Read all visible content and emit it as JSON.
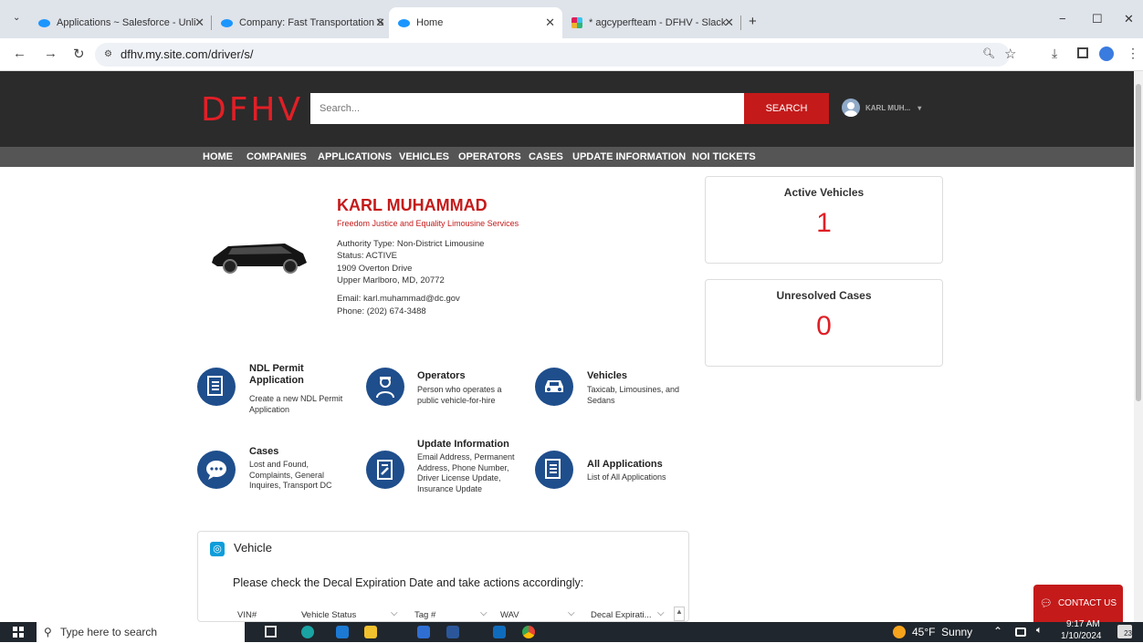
{
  "browser": {
    "tabs": [
      {
        "label": "Applications ~ Salesforce - Unli"
      },
      {
        "label": "Company: Fast Transportation S"
      },
      {
        "label": "Home"
      },
      {
        "label": "* agcyperfteam - DFHV - Slack"
      }
    ],
    "url": "dfhv.my.site.com/driver/s/"
  },
  "header": {
    "logo": "DFHV",
    "search_placeholder": "Search...",
    "search_button": "SEARCH",
    "user_name": "KARL MUH..."
  },
  "nav": {
    "items": [
      "HOME",
      "COMPANIES",
      "APPLICATIONS",
      "VEHICLES",
      "OPERATORS",
      "CASES",
      "UPDATE INFORMATION",
      "NOI TICKETS"
    ]
  },
  "profile": {
    "name": "KARL MUHAMMAD",
    "company": "Freedom Justice and Equality Limousine Services",
    "authority_type": "Authority Type: Non-District Limousine",
    "status": "Status: ACTIVE",
    "address1": "1909 Overton Drive",
    "address2": "Upper Marlboro, MD, 20772",
    "email": "Email: karl.muhammad@dc.gov",
    "phone": "Phone: (202) 674-3488"
  },
  "stats": {
    "active_vehicles": {
      "label": "Active Vehicles",
      "value": "1"
    },
    "unresolved_cases": {
      "label": "Unresolved Cases",
      "value": "0"
    }
  },
  "tiles": [
    {
      "title": "NDL Permit Application",
      "desc": "Create a new NDL Permit Application",
      "icon": "document-icon"
    },
    {
      "title": "Operators",
      "desc": "Person who operates a public vehicle-for-hire",
      "icon": "operator-icon"
    },
    {
      "title": "Vehicles",
      "desc": "Taxicab, Limousines, and Sedans",
      "icon": "car-icon"
    },
    {
      "title": "Cases",
      "desc": "Lost and Found, Complaints, General Inquires, Transport DC",
      "icon": "chat-icon"
    },
    {
      "title": "Update Information",
      "desc": "Email Address, Permanent Address, Phone Number, Driver License Update, Insurance Update",
      "icon": "edit-document-icon"
    },
    {
      "title": "All Applications",
      "desc": "List of All Applications",
      "icon": "document-list-icon"
    }
  ],
  "vehicle_card": {
    "title": "Vehicle",
    "instruction": "Please check the Decal Expiration Date and take actions accordingly:",
    "columns": [
      "VIN#",
      "Vehicle Status",
      "Tag #",
      "WAV",
      "Decal Expirati..."
    ]
  },
  "contact_us": "CONTACT US",
  "taskbar": {
    "search_placeholder": "Type here to search",
    "weather": "45°F  Sunny",
    "time": "9:17 AM",
    "date": "1/10/2024",
    "notifications": "23"
  },
  "colors": {
    "brand_red": "#c41a1a",
    "header_bg": "#2b2b2b",
    "icon_blue": "#1f4e8c"
  }
}
